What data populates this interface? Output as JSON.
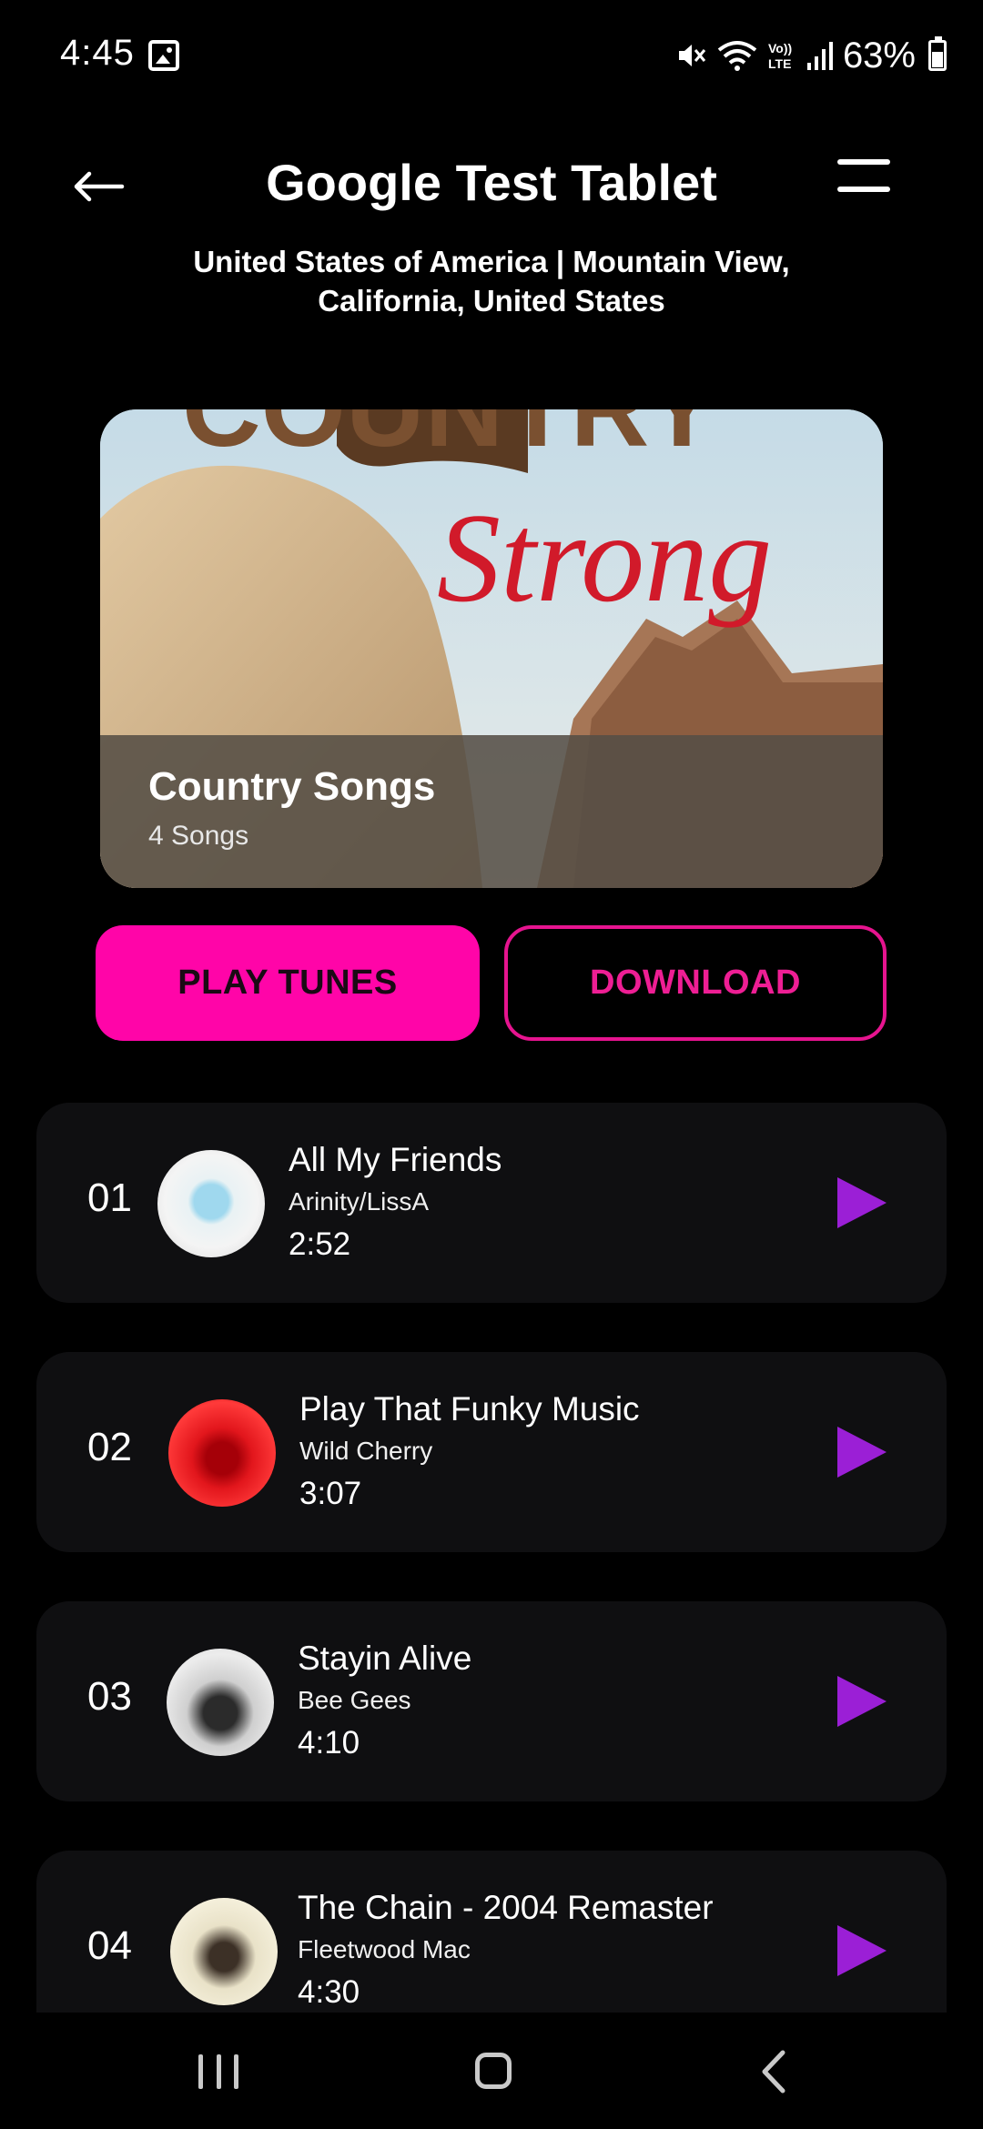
{
  "status_bar": {
    "time": "4:45",
    "battery": "63%",
    "icons": [
      "image-icon",
      "mute-icon",
      "wifi-icon",
      "volte-icon",
      "signal-icon",
      "battery-icon"
    ]
  },
  "header": {
    "title": "Google Test Tablet",
    "subtitle": "United States of America | Mountain View, California, United States"
  },
  "banner": {
    "artwork_text": "Country Strong",
    "title": "Country Songs",
    "count": "4 Songs"
  },
  "actions": {
    "play_label": "PLAY TUNES",
    "download_label": "DOWNLOAD"
  },
  "songs": [
    {
      "num": "01",
      "title": "All My Friends",
      "artist": "Arinity/LissA",
      "duration": "2:52"
    },
    {
      "num": "02",
      "title": "Play That Funky Music",
      "artist": "Wild Cherry",
      "duration": "3:07"
    },
    {
      "num": "03",
      "title": "Stayin Alive",
      "artist": "Bee Gees",
      "duration": "4:10"
    },
    {
      "num": "04",
      "title": "The Chain - 2004 Remaster",
      "artist": "Fleetwood Mac",
      "duration": "4:30"
    }
  ],
  "colors": {
    "background": "#000000",
    "card": "#0f0f11",
    "accent_pink": "#ff05a8",
    "play_purple": "#9b1fd6"
  }
}
